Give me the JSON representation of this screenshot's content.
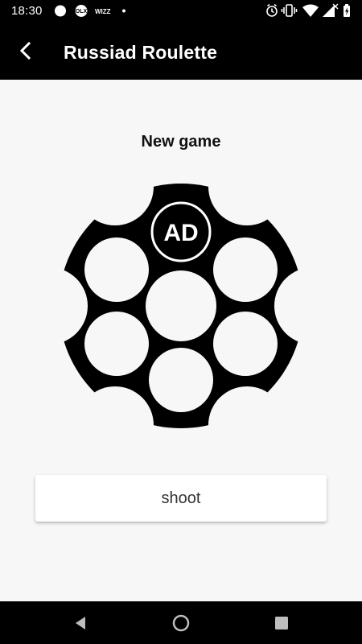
{
  "status_bar": {
    "time": "18:30",
    "left_icons": [
      "circle-notification-icon",
      "olx-app-icon",
      "wizz-app-icon",
      "dot-icon"
    ],
    "left_labels": {
      "olx": "OLX",
      "wizz": "WIZZ"
    },
    "right_icons": [
      "alarm-icon",
      "vibrate-icon",
      "wifi-icon",
      "signal-icon",
      "battery-charging-icon"
    ]
  },
  "app_bar": {
    "title": "Russiad Roulette",
    "back_icon": "chevron-left-icon"
  },
  "main": {
    "game_title": "New game",
    "cylinder": {
      "badge_text": "AD",
      "chambers": 6
    },
    "shoot_label": "shoot"
  },
  "nav_bar": {
    "items": [
      "back-triangle-icon",
      "home-circle-icon",
      "recents-square-icon"
    ]
  },
  "colors": {
    "bar_background": "#000000",
    "page_background": "#f7f7f7",
    "cylinder": "#000000",
    "button_background": "#ffffff"
  }
}
